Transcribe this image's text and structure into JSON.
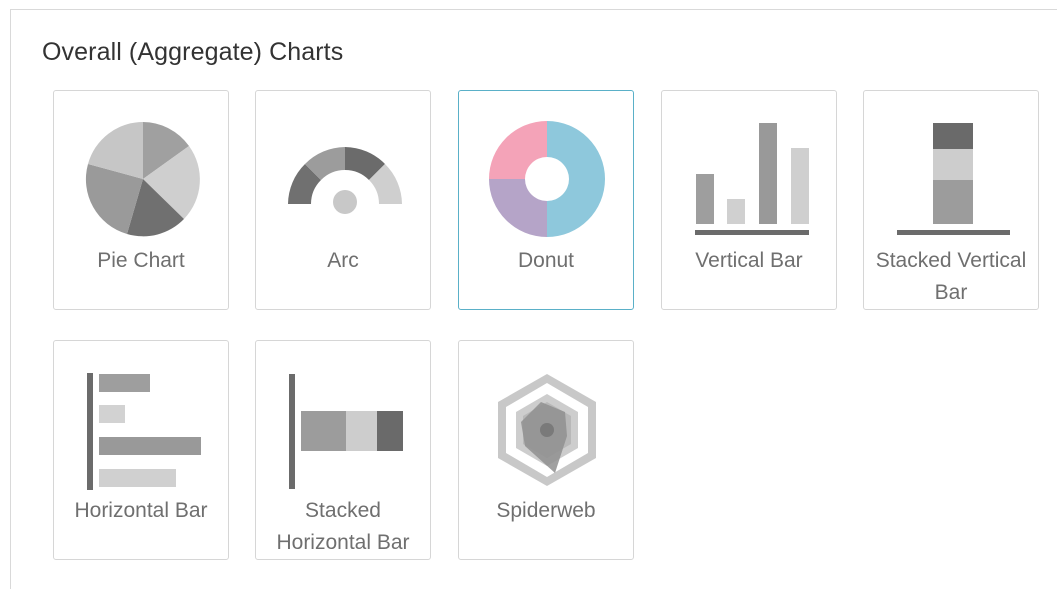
{
  "section": {
    "title": "Overall (Aggregate) Charts"
  },
  "tiles": [
    {
      "label": "Pie Chart",
      "icon": "pie-chart-icon"
    },
    {
      "label": "Arc",
      "icon": "arc-chart-icon"
    },
    {
      "label": "Donut",
      "icon": "donut-chart-icon",
      "selected": true
    },
    {
      "label": "Vertical Bar",
      "icon": "vertical-bar-chart-icon"
    },
    {
      "label_line1": "Stacked Vertical",
      "label_line2": "Bar",
      "icon": "stacked-vertical-bar-chart-icon"
    },
    {
      "label": "Horizontal Bar",
      "icon": "horizontal-bar-chart-icon"
    },
    {
      "label_line1": "Stacked",
      "label_line2": "Horizontal Bar",
      "icon": "stacked-horizontal-bar-chart-icon"
    },
    {
      "label": "Spiderweb",
      "icon": "spiderweb-chart-icon"
    }
  ],
  "colors": {
    "selected_border": "#5ab0c8",
    "donut_pink": "#f4a3b8",
    "donut_blue": "#8ec8dc",
    "donut_purple": "#b5a4c8"
  }
}
